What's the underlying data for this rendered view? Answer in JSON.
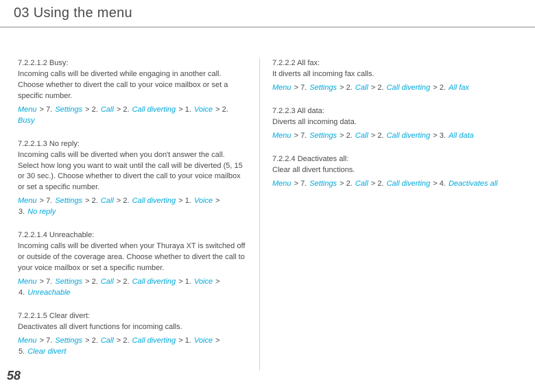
{
  "chapter_title": "03 Using the menu",
  "page_number": "58",
  "left": {
    "s1": {
      "heading": "7.2.2.1.2  Busy:",
      "text": "Incoming calls will be diverted while engaging in another call. Choose whether to divert the call to your voice mailbox or set a specific number.",
      "p": [
        "Menu",
        " > 7. ",
        "Settings",
        " > 2. ",
        "Call",
        " > 2. ",
        "Call diverting",
        " > 1. ",
        "Voice",
        " > 2. ",
        "Busy"
      ]
    },
    "s2": {
      "heading": "7.2.2.1.3  No reply:",
      "text": "Incoming calls will be diverted when you don't answer the call. Select how long you want to wait until the call will be diverted (5, 15 or 30 sec.). Choose whether to divert the call to your voice mailbox or set a specific number.",
      "p1": [
        "Menu",
        " > 7. ",
        "Settings",
        " > 2. ",
        "Call",
        " > 2. ",
        "Call diverting",
        " > 1. ",
        "Voice",
        " > "
      ],
      "p2": [
        "3. ",
        "No reply"
      ]
    },
    "s3": {
      "heading": "7.2.2.1.4  Unreachable:",
      "text": "Incoming calls will be diverted when your Thuraya XT is switched off or outside of the coverage area. Choose whether to divert the call to your voice mailbox or set a specific number.",
      "p1": [
        "Menu",
        " > 7. ",
        "Settings",
        " > 2. ",
        "Call",
        " > 2. ",
        "Call diverting",
        " > 1. ",
        "Voice",
        " > "
      ],
      "p2": [
        "4. ",
        "Unreachable"
      ]
    },
    "s4": {
      "heading": "7.2.2.1.5  Clear divert:",
      "text": "Deactivates all divert functions for incoming calls.",
      "p1": [
        "Menu",
        " > 7. ",
        "Settings",
        " > 2. ",
        "Call",
        " > 2. ",
        "Call diverting",
        " > 1. ",
        "Voice",
        " > "
      ],
      "p2": [
        "5. ",
        "Clear divert"
      ]
    }
  },
  "right": {
    "s1": {
      "heading": "7.2.2.2  All fax:",
      "text": "It diverts all incoming fax calls.",
      "p": [
        "Menu",
        " > 7. ",
        "Settings",
        " > 2. ",
        "Call",
        " > 2. ",
        "Call diverting",
        " > 2. ",
        "All fax"
      ]
    },
    "s2": {
      "heading": "7.2.2.3  All data:",
      "text": "Diverts all incoming data.",
      "p": [
        "Menu",
        " > 7. ",
        "Settings",
        " > 2. ",
        "Call",
        " > 2. ",
        "Call diverting",
        " > 3. ",
        "All data"
      ]
    },
    "s3": {
      "heading": "7.2.2.4  Deactivates all:",
      "text": "Clear all divert functions.",
      "p": [
        "Menu",
        " > 7. ",
        "Settings",
        " > 2. ",
        "Call",
        " > 2. ",
        "Call diverting",
        " > 4. ",
        "Deactivates all"
      ]
    }
  }
}
